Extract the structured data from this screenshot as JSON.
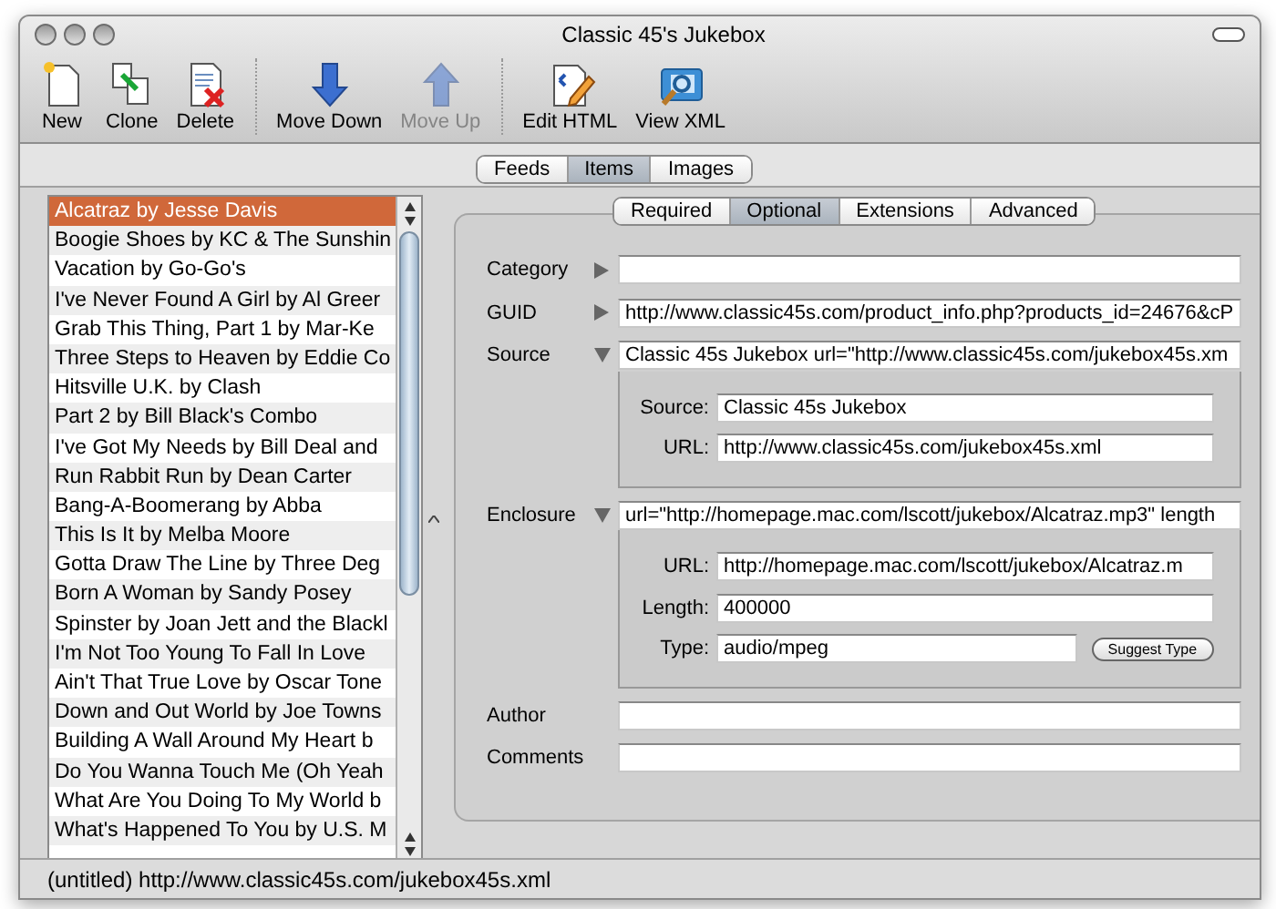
{
  "window": {
    "title": "Classic 45's Jukebox"
  },
  "toolbar_groups": [
    [
      {
        "kind": "new",
        "label": "New",
        "disabled": false
      },
      {
        "kind": "clone",
        "label": "Clone",
        "disabled": false
      },
      {
        "kind": "delete",
        "label": "Delete",
        "disabled": false
      }
    ],
    [
      {
        "kind": "down",
        "label": "Move Down",
        "disabled": false
      },
      {
        "kind": "up",
        "label": "Move Up",
        "disabled": true
      }
    ],
    [
      {
        "kind": "html",
        "label": "Edit HTML",
        "disabled": false
      },
      {
        "kind": "xml",
        "label": "View XML",
        "disabled": false
      }
    ]
  ],
  "view_tabs": [
    {
      "label": "Feeds",
      "selected": false
    },
    {
      "label": "Items",
      "selected": true
    },
    {
      "label": "Images",
      "selected": false
    }
  ],
  "items": [
    {
      "label": "Alcatraz by Jesse Davis",
      "selected": true
    },
    {
      "label": "Boogie Shoes by KC & The Sunshin",
      "selected": false
    },
    {
      "label": "Vacation by Go-Go's",
      "selected": false
    },
    {
      "label": "I've Never Found A Girl by Al Greer",
      "selected": false
    },
    {
      "label": "Grab This Thing, Part 1 by Mar-Ke",
      "selected": false
    },
    {
      "label": "Three Steps to Heaven by Eddie Co",
      "selected": false
    },
    {
      "label": "Hitsville U.K. by Clash",
      "selected": false
    },
    {
      "label": "Part 2 by Bill Black's Combo",
      "selected": false
    },
    {
      "label": "I've Got My Needs by Bill Deal and",
      "selected": false
    },
    {
      "label": "Run Rabbit Run by Dean Carter",
      "selected": false
    },
    {
      "label": "Bang-A-Boomerang by Abba",
      "selected": false
    },
    {
      "label": "This Is It by Melba Moore",
      "selected": false
    },
    {
      "label": "Gotta Draw The Line by Three Deg",
      "selected": false
    },
    {
      "label": "Born A Woman by Sandy Posey",
      "selected": false
    },
    {
      "label": "Spinster by Joan Jett and the Blackl",
      "selected": false
    },
    {
      "label": "I'm Not Too Young To Fall In Love",
      "selected": false
    },
    {
      "label": "Ain't That True Love by Oscar Tone",
      "selected": false
    },
    {
      "label": "Down and Out World by Joe Towns",
      "selected": false
    },
    {
      "label": "Building A Wall Around My Heart b",
      "selected": false
    },
    {
      "label": "Do You Wanna Touch Me (Oh Yeah",
      "selected": false
    },
    {
      "label": "What Are You Doing To My World b",
      "selected": false
    },
    {
      "label": "What's Happened To You by U.S. M",
      "selected": false
    }
  ],
  "detail_tabs": [
    {
      "label": "Required",
      "selected": false
    },
    {
      "label": "Optional",
      "selected": true
    },
    {
      "label": "Extensions",
      "selected": false
    },
    {
      "label": "Advanced",
      "selected": false
    }
  ],
  "fields": [
    {
      "kind": "disclosure",
      "label": "Category",
      "expanded": false
    },
    {
      "kind": "disclosure",
      "label": "GUID",
      "expanded": false,
      "value": "http://www.classic45s.com/product_info.php?products_id=24676&cP"
    },
    {
      "kind": "disclosure",
      "label": "Source",
      "expanded": true,
      "value": "Classic 45s Jukebox url=\"http://www.classic45s.com/jukebox45s.xm",
      "children": [
        {
          "label": "Source:",
          "value": "Classic 45s Jukebox"
        },
        {
          "label": "URL:",
          "value": "http://www.classic45s.com/jukebox45s.xml"
        }
      ]
    },
    {
      "kind": "disclosure",
      "label": "Enclosure",
      "expanded": true,
      "value": "url=\"http://homepage.mac.com/lscott/jukebox/Alcatraz.mp3\" length",
      "children": [
        {
          "label": "URL:",
          "value": "http://homepage.mac.com/lscott/jukebox/Alcatraz.m"
        },
        {
          "label": "Length:",
          "value": "400000"
        },
        {
          "label": "Type:",
          "value": "audio/mpeg",
          "button": "Suggest Type"
        }
      ]
    },
    {
      "kind": "plain",
      "label": "Author"
    },
    {
      "kind": "plain",
      "label": "Comments"
    }
  ],
  "status_bar": "(untitled) http://www.classic45s.com/jukebox45s.xml"
}
